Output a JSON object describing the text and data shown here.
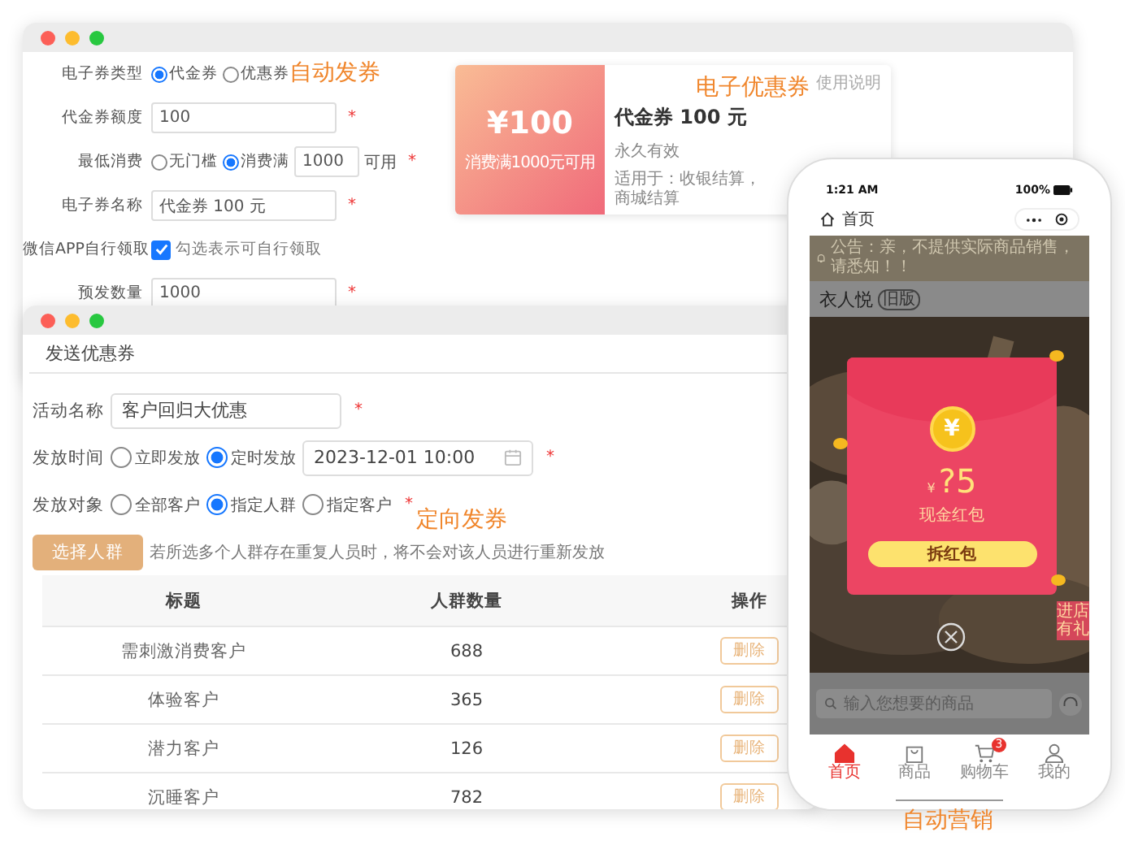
{
  "captions": [
    "自动发券",
    "电子优惠券",
    "定向发券",
    "自动营销"
  ],
  "coupon_form": {
    "fields": [
      {
        "kind": "radio",
        "label": "电子券类型",
        "options": [
          {
            "label": "代金券",
            "selected": true
          },
          {
            "label": "优惠券",
            "selected": false
          }
        ]
      },
      {
        "kind": "input",
        "label": "代金券额度",
        "value": "100",
        "required_mark": "*"
      },
      {
        "kind": "radio_input",
        "label": "最低消费",
        "required_mark": "*",
        "options": [
          {
            "label": "无门槛",
            "selected": false
          },
          {
            "label": "消费满",
            "selected": true
          }
        ],
        "value": "1000",
        "suffix": "可用"
      },
      {
        "kind": "input",
        "label": "电子券名称",
        "value": "代金券 100 元",
        "required_mark": "*"
      },
      {
        "kind": "checkbox",
        "label": "微信APP自行领取",
        "checked": true,
        "text": "勾选表示可自行领取"
      },
      {
        "kind": "input",
        "label": "预发数量",
        "value": "1000",
        "required_mark": "*"
      }
    ]
  },
  "coupon_card": {
    "amount": "¥100",
    "condition": "消费满1000元可用",
    "help_link": "使用说明",
    "title": "代金券 100 元",
    "validity": "永久有效",
    "scope": "适用于：收银结算，商城结算"
  },
  "send_window": {
    "header": "发送优惠券",
    "fields": [
      {
        "kind": "input",
        "label": "活动名称",
        "value": "客户回归大优惠",
        "required_mark": "*"
      },
      {
        "kind": "radio_date",
        "label": "发放时间",
        "required_mark": "*",
        "options": [
          {
            "label": "立即发放",
            "selected": false
          },
          {
            "label": "定时发放",
            "selected": true
          }
        ],
        "value": "2023-12-01 10:00"
      },
      {
        "kind": "radio",
        "label": "发放对象",
        "required_mark": "*",
        "options": [
          {
            "label": "全部客户",
            "selected": false
          },
          {
            "label": "指定人群",
            "selected": true
          },
          {
            "label": "指定客户",
            "selected": false
          }
        ]
      }
    ],
    "select_button": "选择人群",
    "hint": "若所选多个人群存在重复人员时，将不会对该人员进行重新发放",
    "table": {
      "columns": [
        "标题",
        "人群数量",
        "操作"
      ],
      "rows": [
        {
          "title": "需刺激消费客户",
          "count": "688",
          "action": "删除"
        },
        {
          "title": "体验客户",
          "count": "365",
          "action": "删除"
        },
        {
          "title": "潜力客户",
          "count": "126",
          "action": "删除"
        },
        {
          "title": "沉睡客户",
          "count": "782",
          "action": "删除"
        }
      ]
    }
  },
  "phone": {
    "time": "1:21 AM",
    "battery": "100%",
    "nav_title": "首页",
    "notice": "公告：亲，不提供实际商品销售，请悉知！！",
    "store_name": "衣人悦",
    "store_badge": "旧版",
    "red_packet": {
      "coin_symbol": "¥",
      "currency": "¥",
      "amount": "?5",
      "label": "现金红包",
      "button": "拆红包"
    },
    "side_tag": "进店有礼",
    "search_placeholder": "输入您想要的商品",
    "tabs": [
      {
        "kind": "home",
        "label": "首页",
        "selected": true
      },
      {
        "kind": "bag",
        "label": "商品",
        "selected": false
      },
      {
        "kind": "cart",
        "label": "购物车",
        "selected": false,
        "badge": "3"
      },
      {
        "kind": "user",
        "label": "我的",
        "selected": false
      }
    ]
  }
}
